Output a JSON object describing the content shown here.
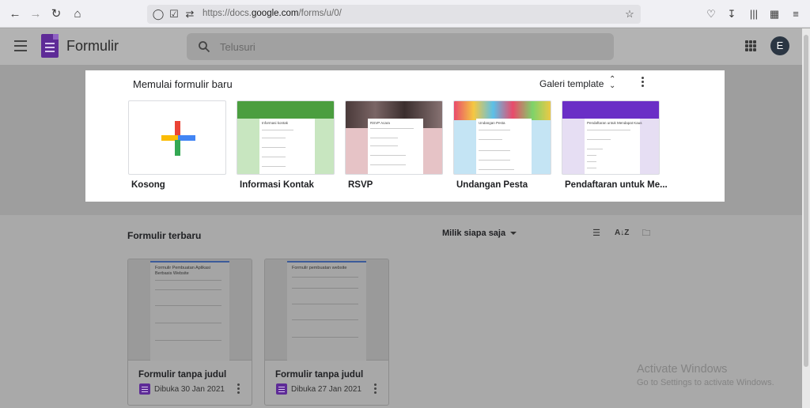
{
  "browser": {
    "url_prefix": "https://docs.",
    "url_domain": "google.com",
    "url_path": "/forms/u/0/"
  },
  "app": {
    "title": "Formulir",
    "search_placeholder": "Telusuri",
    "avatar_letter": "E"
  },
  "templates": {
    "heading": "Memulai formulir baru",
    "gallery_label": "Galeri template",
    "items": [
      {
        "label": "Kosong",
        "icon": "plus-icon"
      },
      {
        "label": "Informasi Kontak",
        "color": "#c8e6c0",
        "form_title": "Informasi kontak"
      },
      {
        "label": "RSVP",
        "color": "#e6c3c6",
        "form_title": "RSVP Acara"
      },
      {
        "label": "Undangan Pesta",
        "color": "#c4e4f4",
        "form_title": "Undangan Pesta"
      },
      {
        "label": "Pendaftaran untuk Me...",
        "color": "#e6def3",
        "form_title": "Pendaftaran untuk Mendapat Kaus"
      }
    ]
  },
  "recent": {
    "heading": "Formulir terbaru",
    "owner_filter": "Milik siapa saja",
    "forms": [
      {
        "name": "Formulir tanpa judul",
        "date": "Dibuka 30 Jan 2021",
        "doc_title": "Formulir Pembuatan Aplikasi Berbasis Website"
      },
      {
        "name": "Formulir tanpa judul",
        "date": "Dibuka 27 Jan 2021",
        "doc_title": "Formulir pembuatan website"
      }
    ]
  },
  "watermark": {
    "title": "Activate Windows",
    "subtitle": "Go to Settings to activate Windows."
  },
  "colors": {
    "forms_purple": "#5e2b97",
    "google_red": "#ea4335",
    "google_blue": "#4285f4",
    "google_yellow": "#fbbc04",
    "google_green": "#34a853"
  }
}
